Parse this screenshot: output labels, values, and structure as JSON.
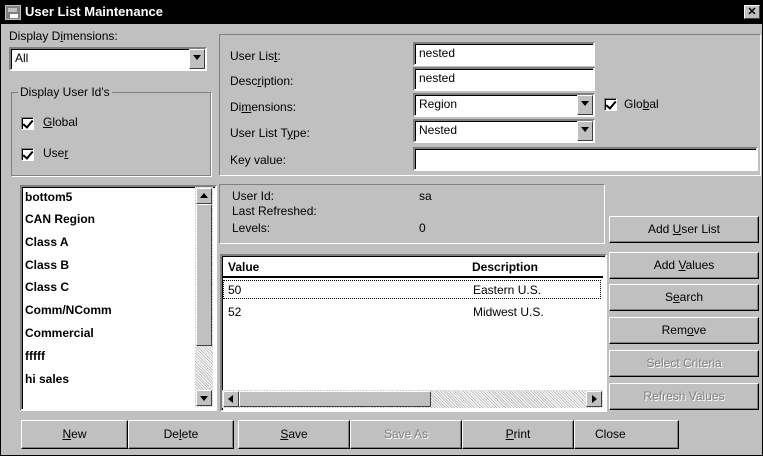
{
  "window": {
    "title": "User List Maintenance",
    "close_glyph": "✕"
  },
  "display_dimensions": {
    "label_pre": "Display D",
    "label_u": "i",
    "label_post": "mensions:",
    "selected": "All"
  },
  "display_user_ids": {
    "legend": "Display User Id's",
    "global": {
      "pre": "",
      "u": "G",
      "post": "lobal",
      "checked": true
    },
    "user": {
      "pre": "Use",
      "u": "r",
      "post": "",
      "checked": true
    }
  },
  "form": {
    "user_list": {
      "pre": "User Lis",
      "u": "t",
      "post": ":",
      "value": "nested"
    },
    "description": {
      "pre": "Desc",
      "u": "r",
      "post": "iption:",
      "value": "nested"
    },
    "dimensions": {
      "pre": "Di",
      "u": "m",
      "post": "ensions:",
      "value": "Region"
    },
    "user_list_type": {
      "pre": "User List T",
      "u": "y",
      "post": "pe:",
      "value": "Nested"
    },
    "key_value": {
      "label": "Key value:",
      "value": ""
    },
    "global_check": {
      "pre": "Glo",
      "u": "b",
      "post": "al",
      "checked": true
    }
  },
  "user_lists": [
    "bottom5",
    "CAN Region",
    "Class A",
    "Class B",
    "Class C",
    "Comm/NComm",
    "Commercial",
    "fffff",
    "hi sales"
  ],
  "info": {
    "user_id_label": "User Id:",
    "user_id_value": "sa",
    "last_refreshed_label": "Last Refreshed:",
    "last_refreshed_value": "",
    "levels_label": "Levels:",
    "levels_value": "0"
  },
  "grid": {
    "columns": [
      "Value",
      "Description"
    ],
    "rows": [
      {
        "value": "50",
        "description": "Eastern U.S."
      },
      {
        "value": "52",
        "description": "Midwest U.S."
      }
    ]
  },
  "side_buttons": {
    "add_user_list": {
      "pre": "Add ",
      "u": "U",
      "post": "ser List"
    },
    "add_values": {
      "pre": "Add ",
      "u": "V",
      "post": "alues"
    },
    "search": {
      "pre": "S",
      "u": "e",
      "post": "arch"
    },
    "remove": {
      "pre": "Rem",
      "u": "o",
      "post": "ve"
    },
    "select_criteria": "Select Criteria",
    "refresh_values": "Refresh Values"
  },
  "bottom_buttons": {
    "new": {
      "pre": "",
      "u": "N",
      "post": "ew"
    },
    "delete": {
      "pre": "De",
      "u": "l",
      "post": "ete"
    },
    "save": {
      "pre": "",
      "u": "S",
      "post": "ave"
    },
    "save_as": "Save As",
    "print": {
      "pre": "",
      "u": "P",
      "post": "rint"
    },
    "close": "Close"
  }
}
